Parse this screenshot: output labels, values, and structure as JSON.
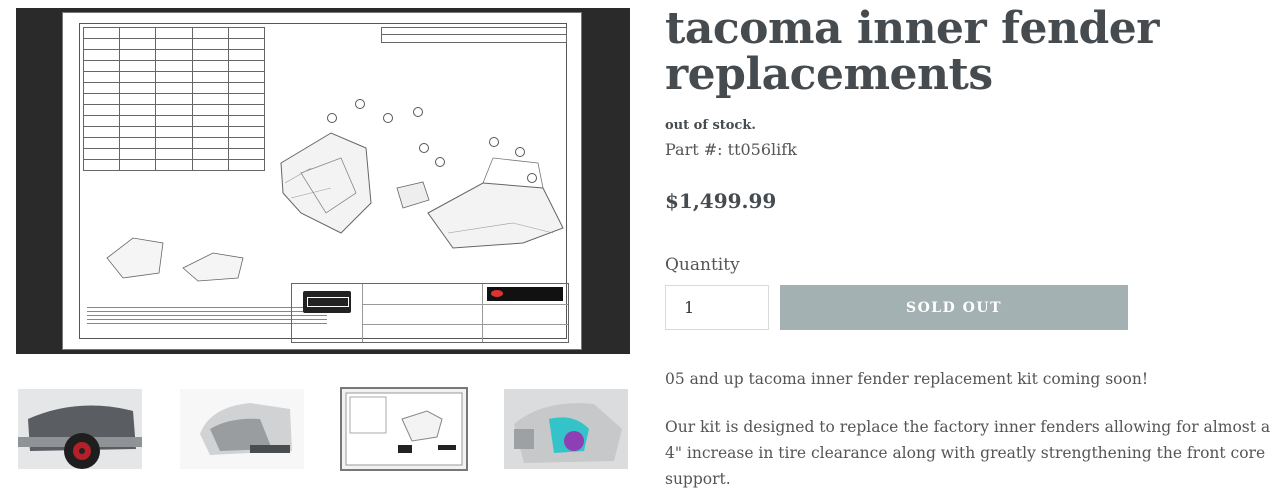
{
  "product": {
    "title": "tacoma inner fender replacements",
    "stock_status": "out of stock.",
    "part_number": "Part #: tt056lifk",
    "price": "$1,499.99",
    "quantity_label": "Quantity",
    "quantity_value": "1",
    "button_label": "SOLD OUT",
    "description": [
      "05 and up tacoma inner fender replacement kit coming soon!",
      "Our kit is designed to replace the factory inner fenders allowing for almost a 4\" increase in tire clearance along with greatly strengthening the front core support."
    ]
  },
  "gallery": {
    "thumbnails": [
      "fender-render-1",
      "fender-render-2",
      "drawing-sheet",
      "fender-render-3"
    ],
    "active_index": 2
  },
  "colors": {
    "title": "#454b4f",
    "button_bg": "#a4b1b3",
    "body_text": "#555555"
  }
}
